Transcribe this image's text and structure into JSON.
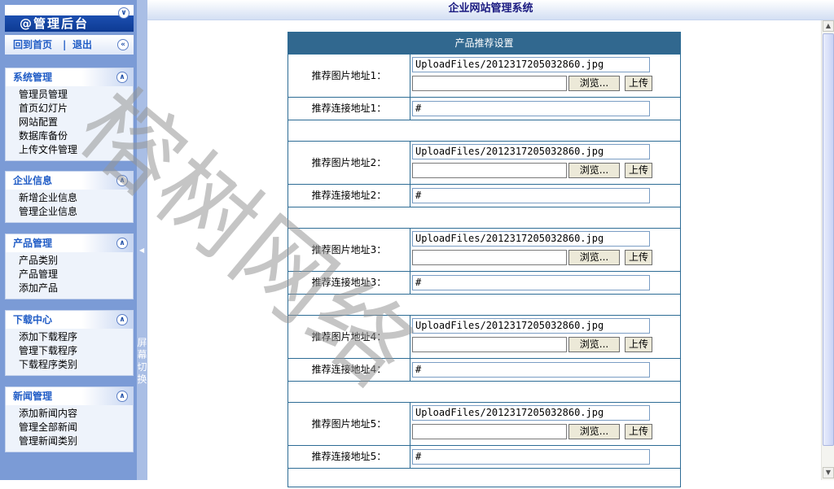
{
  "app": {
    "brand": "@管理后台",
    "header_title": "企业网站管理系统"
  },
  "quicklinks": {
    "home": "回到首页",
    "separator": "|",
    "logout": "退出"
  },
  "sidebar": {
    "groups": [
      {
        "title": "系统管理",
        "items": [
          "管理员管理",
          "首页幻灯片",
          "网站配置",
          "数据库备份",
          "上传文件管理"
        ]
      },
      {
        "title": "企业信息",
        "items": [
          "新增企业信息",
          "管理企业信息"
        ]
      },
      {
        "title": "产品管理",
        "items": [
          "产品类别",
          "产品管理",
          "添加产品"
        ]
      },
      {
        "title": "下载中心",
        "items": [
          "添加下载程序",
          "管理下载程序",
          "下载程序类别"
        ]
      },
      {
        "title": "新闻管理",
        "items": [
          "添加新闻内容",
          "管理全部新闻",
          "管理新闻类别"
        ]
      }
    ],
    "toggle_label": "屏幕切换"
  },
  "panel": {
    "title": "产品推荐设置",
    "browse_label": "浏览...",
    "upload_label": "上传",
    "rows": [
      {
        "img_label": "推荐图片地址1：",
        "img_value": "UploadFiles/2012317205032860.jpg",
        "link_label": "推荐连接地址1：",
        "link_value": "#"
      },
      {
        "img_label": "推荐图片地址2：",
        "img_value": "UploadFiles/2012317205032860.jpg",
        "link_label": "推荐连接地址2：",
        "link_value": "#"
      },
      {
        "img_label": "推荐图片地址3：",
        "img_value": "UploadFiles/2012317205032860.jpg",
        "link_label": "推荐连接地址3：",
        "link_value": "#"
      },
      {
        "img_label": "推荐图片地址4：",
        "img_value": "UploadFiles/2012317205032860.jpg",
        "link_label": "推荐连接地址4：",
        "link_value": "#"
      },
      {
        "img_label": "推荐图片地址5：",
        "img_value": "UploadFiles/2012317205032860.jpg",
        "link_label": "推荐连接地址5：",
        "link_value": "#"
      }
    ]
  },
  "watermark": "榕树网络",
  "colors": {
    "sidebar_bg": "#7b9bd6",
    "brand_bar": "#1c4fb0",
    "panel_header": "#31688f",
    "border": "#2d6c95"
  }
}
